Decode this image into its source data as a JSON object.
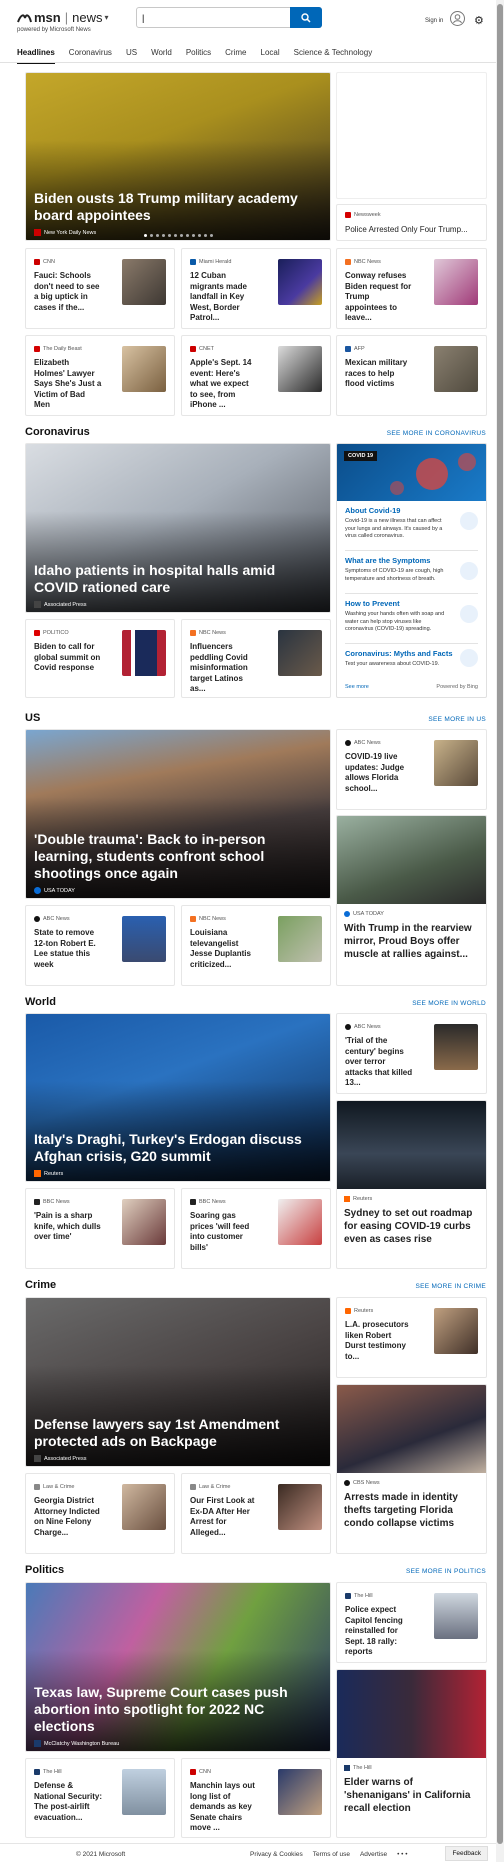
{
  "brand": {
    "logo": "msn",
    "product": "news",
    "powered": "powered by Microsoft News"
  },
  "search": {
    "placeholder": "",
    "value": "|"
  },
  "header": {
    "signin": "Sign in"
  },
  "nav": [
    "Headlines",
    "Coronavirus",
    "US",
    "World",
    "Politics",
    "Crime",
    "Local",
    "Science & Technology"
  ],
  "top": {
    "hero": {
      "title": "Biden ousts 18 Trump military academy board appointees",
      "source": "New York Daily News"
    },
    "side_top": {
      "source": "Newsweek",
      "title": "Police Arrested Only Four Trump..."
    },
    "smalls": [
      {
        "source": "CNN",
        "title": "Fauci: Schools don't need to see a big uptick in cases if the..."
      },
      {
        "source": "Miami Herald",
        "title": "12 Cuban migrants made landfall in Key West, Border Patrol..."
      },
      {
        "source": "NBC News",
        "title": "Conway refuses Biden request for Trump appointees to leave..."
      },
      {
        "source": "The Daily Beast",
        "title": "Elizabeth Holmes' Lawyer Says She's Just a Victim of Bad Men"
      },
      {
        "source": "CNET",
        "title": "Apple's Sept. 14 event: Here's what we expect to see, from iPhone ..."
      },
      {
        "source": "AFP",
        "title": "Mexican military races to help flood victims"
      }
    ]
  },
  "coronavirus": {
    "heading": "Coronavirus",
    "see_more": "SEE MORE IN CORONAVIRUS",
    "hero": {
      "title": "Idaho patients in hospital halls amid COVID rationed care",
      "source": "Associated Press"
    },
    "smalls": [
      {
        "source": "POLITICO",
        "title": "Biden to call for global summit on Covid response"
      },
      {
        "source": "NBC News",
        "title": "Influencers peddling Covid misinformation target Latinos as..."
      }
    ],
    "widget": {
      "badge": "COVID 19",
      "sections": [
        {
          "h": "About Covid-19",
          "d": "Covid-19 is a new illness that can affect your lungs and airways. It's caused by a virus called coronavirus."
        },
        {
          "h": "What are the Symptoms",
          "d": "Symptoms of COVID-19 are cough, high temperature and shortness of breath."
        },
        {
          "h": "How to Prevent",
          "d": "Washing your hands often with soap and water can help stop viruses like coronavirus (COVID-19) spreading."
        },
        {
          "h": "Coronavirus: Myths and Facts",
          "d": "Test your awareness about COVID-19."
        }
      ],
      "see_more": "See more",
      "powered": "Powered by Bing"
    }
  },
  "us": {
    "heading": "US",
    "see_more": "SEE MORE IN US",
    "hero": {
      "title": "'Double trauma': Back to in-person learning, students confront school shootings once again",
      "source": "USA TODAY"
    },
    "side_small": {
      "source": "ABC News",
      "title": "COVID-19 live updates: Judge allows Florida school..."
    },
    "smalls": [
      {
        "source": "ABC News",
        "title": "State to remove 12-ton Robert E. Lee statue this week"
      },
      {
        "source": "NBC News",
        "title": "Louisiana televangelist Jesse Duplantis criticized..."
      }
    ],
    "tall": {
      "source": "USA TODAY",
      "title": "With Trump in the rearview mirror, Proud Boys offer muscle at rallies against..."
    }
  },
  "world": {
    "heading": "World",
    "see_more": "SEE MORE IN WORLD",
    "hero": {
      "title": "Italy's Draghi, Turkey's Erdogan discuss Afghan crisis, G20 summit",
      "source": "Reuters"
    },
    "side_small": {
      "source": "ABC News",
      "title": "'Trial of the century' begins over terror attacks that killed 13..."
    },
    "smalls": [
      {
        "source": "BBC News",
        "title": "'Pain is a sharp knife, which dulls over time'"
      },
      {
        "source": "BBC News",
        "title": "Soaring gas prices 'will feed into customer bills'"
      }
    ],
    "tall": {
      "source": "Reuters",
      "title": "Sydney to set out roadmap for easing COVID-19 curbs even as cases rise"
    }
  },
  "crime": {
    "heading": "Crime",
    "see_more": "SEE MORE IN CRIME",
    "hero": {
      "title": "Defense lawyers say 1st Amendment protected ads on Backpage",
      "source": "Associated Press"
    },
    "side_small": {
      "source": "Reuters",
      "title": "L.A. prosecutors liken Robert Durst testimony to..."
    },
    "smalls": [
      {
        "source": "Law & Crime",
        "title": "Georgia District Attorney Indicted on Nine Felony Charge..."
      },
      {
        "source": "Law & Crime",
        "title": "Our First Look at Ex-DA After Her Arrest for Alleged..."
      }
    ],
    "tall": {
      "source": "CBS News",
      "title": "Arrests made in identity thefts targeting Florida condo collapse victims"
    }
  },
  "politics": {
    "heading": "Politics",
    "see_more": "SEE MORE IN POLITICS",
    "hero": {
      "title": "Texas law, Supreme Court cases push abortion into spotlight for 2022 NC elections",
      "source": "McClatchy Washington Bureau"
    },
    "side_small": {
      "source": "The Hill",
      "title": "Police expect Capitol fencing reinstalled for Sept. 18 rally: reports"
    },
    "smalls": [
      {
        "source": "The Hill",
        "title": "Defense & National Security: The post-airlift evacuation..."
      },
      {
        "source": "CNN",
        "title": "Manchin lays out long list of demands as key Senate chairs move ..."
      }
    ],
    "tall": {
      "source": "The Hill",
      "title": "Elder warns of 'shenanigans' in California recall election"
    }
  },
  "footer": {
    "copyright": "© 2021 Microsoft",
    "links": [
      "Privacy & Cookies",
      "Terms of use",
      "Advertise",
      "• • •"
    ],
    "feedback": "Feedback"
  }
}
